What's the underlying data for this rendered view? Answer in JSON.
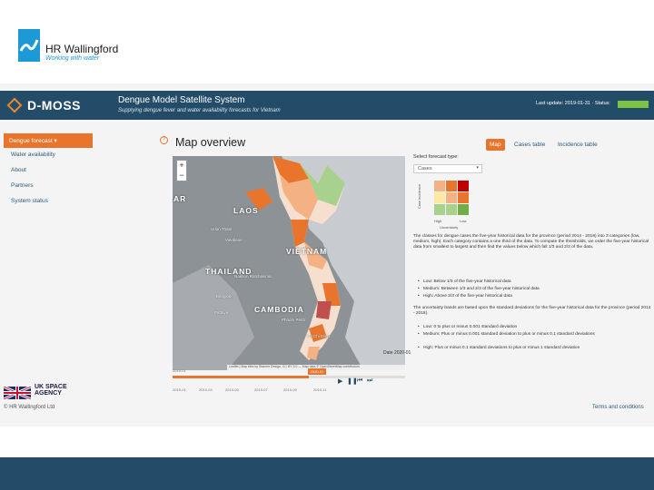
{
  "slide": {
    "logo_name": "HR Wallingford",
    "logo_tagline": "Working with water",
    "copyright": "© HR Wallingford Ltd",
    "uk_space_line1": "UK SPACE",
    "uk_space_line2": "AGENCY",
    "terms": "Terms and conditions"
  },
  "header": {
    "brand": "D-MOSS",
    "title": "Dengue Model Satellite System",
    "subtitle": "Supplying dengue fever and water availability forecasts for Vietnam",
    "last_update": "Last update: 2019-01-31 · Status:",
    "status_color": "#7dc242"
  },
  "sidebar": {
    "items": [
      {
        "label": "Dengue forecast ▾",
        "active": true
      },
      {
        "label": "Water availability"
      },
      {
        "label": "About"
      },
      {
        "label": "Partners"
      },
      {
        "label": "System status"
      }
    ]
  },
  "map": {
    "help": "?",
    "title": "Map overview",
    "zoom_in": "+",
    "zoom_out": "−",
    "countries": [
      "LAOS",
      "VIETNAM",
      "THAILAND",
      "CAMBODIA",
      "AR"
    ],
    "cities": [
      "Vientiane",
      "Bangkok",
      "Pattaya",
      "Phnom Penh",
      "Ho Chi Minh",
      "Nakhon Ratchasima",
      "Udon Thani"
    ],
    "date_label": "Date 2020-01",
    "attribution": "Leaflet | Map tiles by Stamen Design, CC BY 3.0 — Map data © OpenStreetMap contributors",
    "timeline_start": "2019-01",
    "timeline_current": "2020-01",
    "ticks": [
      "2019-01",
      "2019-03",
      "2019-05",
      "2019-07",
      "2019-09",
      "2019-11"
    ],
    "player": [
      "▶",
      "❚❚",
      "⏮",
      "⏭"
    ]
  },
  "tabs": [
    {
      "label": "Map",
      "active": true
    },
    {
      "label": "Cases table"
    },
    {
      "label": "Incidence table"
    }
  ],
  "forecast": {
    "select_label": "Select forecast type:",
    "select_value": "Cases",
    "axis_vertical": "Case incidence",
    "axis_low": "High",
    "axis_high": "Low",
    "axis_horizontal": "Uncertainty",
    "matrix_colors": [
      [
        "#f4b183",
        "#e8752b",
        "#c00000"
      ],
      [
        "#fde9a3",
        "#f4b183",
        "#e8752b"
      ],
      [
        "#a9d18e",
        "#a9d18e",
        "#70ad47"
      ]
    ],
    "paragraph1": "The classes for dengue cases the five-year historical data for the province (period 2014 - 2018) into 3 categories (low, medium, high). Each category contains a one third of the data. To compute the thresholds, we order the five-year historical data from smallest to largest and then find the values below which fall 1/3 and 2/3 of the data.",
    "bullets1": [
      "Low: Below 1/3 of the five-year historical data",
      "Medium: Between 1/3 and 2/3 of the five-year historical data",
      "High: Above 2/3 of the five-year historical data"
    ],
    "paragraph2": "The uncertainty bands are based upon the standard deviations for the five-year historical data for the province (period 2014 - 2018).",
    "bullets2": [
      "Low: 0 to plus or minus 0.001 standard deviation",
      "Medium: Plus or minus 0.001 standard deviation to plus or minus 0.1 standard deviations",
      "High: Plus or minus 0.1 standard deviations to plus or minus 1 standard deviation"
    ]
  }
}
